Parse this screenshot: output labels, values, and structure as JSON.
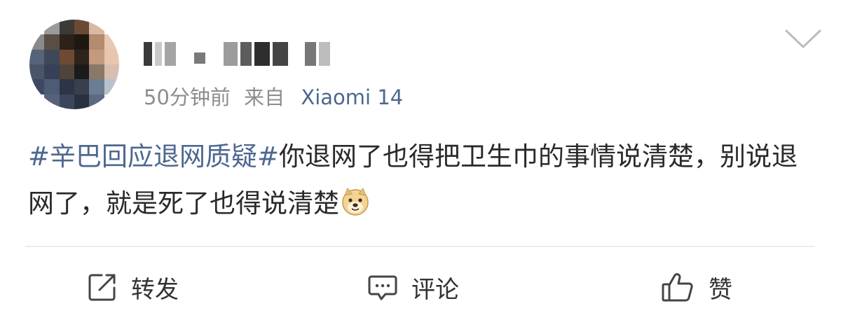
{
  "post": {
    "time": "50分钟前",
    "source_prefix": "来自",
    "source_device": "Xiaomi 14",
    "hashtag": "#辛巴回应退网质疑#",
    "text": "你退网了也得把卫生巾的事情说清楚，别说退网了，就是死了也得说清楚",
    "emoji_icon": "doge-icon"
  },
  "actions": {
    "share_label": "转发",
    "comment_label": "评论",
    "like_label": "赞"
  },
  "colors": {
    "link": "#4d6790",
    "meta": "#8d8d8d",
    "text": "#2a2a2a",
    "divider": "#ececec"
  }
}
